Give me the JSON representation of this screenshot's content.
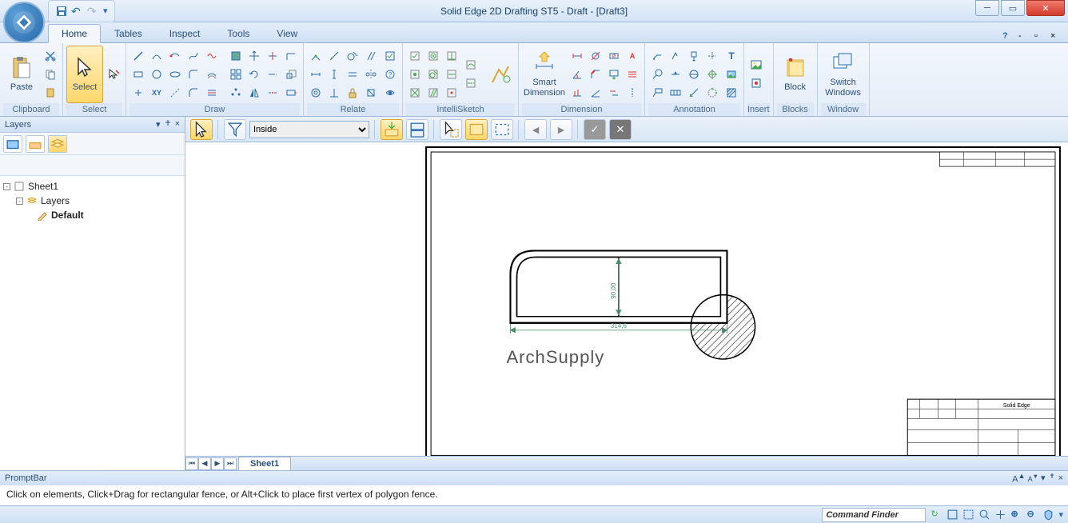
{
  "app": {
    "title": "Solid Edge 2D Drafting ST5 - Draft - [Draft3]"
  },
  "tabs": [
    "Home",
    "Tables",
    "Inspect",
    "Tools",
    "View"
  ],
  "active_tab": 0,
  "ribbon": {
    "clipboard": {
      "label": "Clipboard",
      "paste": "Paste"
    },
    "select": {
      "label": "Select",
      "select": "Select"
    },
    "draw": {
      "label": "Draw"
    },
    "relate": {
      "label": "Relate"
    },
    "intellisketch": {
      "label": "IntelliSketch"
    },
    "dimension": {
      "label": "Dimension",
      "smart": "Smart\nDimension"
    },
    "annotation": {
      "label": "Annotation"
    },
    "insert": {
      "label": "Insert"
    },
    "blocks": {
      "label": "Blocks",
      "block": "Block"
    },
    "window": {
      "label": "Window",
      "switch": "Switch\nWindows"
    }
  },
  "layers_panel": {
    "title": "Layers",
    "tree": {
      "sheet": "Sheet1",
      "layers": "Layers",
      "default": "Default"
    }
  },
  "command_bar": {
    "mode": "Inside"
  },
  "canvas": {
    "dim_v": "90,00",
    "dim_h": "314,6",
    "watermark": "ArchSupply",
    "titleblock": "Solid Edge"
  },
  "sheet_tab": "Sheet1",
  "promptbar": {
    "title": "PromptBar",
    "text": "Click on elements, Click+Drag for rectangular fence, or Alt+Click to place first vertex of polygon fence."
  },
  "status": {
    "cmdfinder": "Command Finder"
  }
}
